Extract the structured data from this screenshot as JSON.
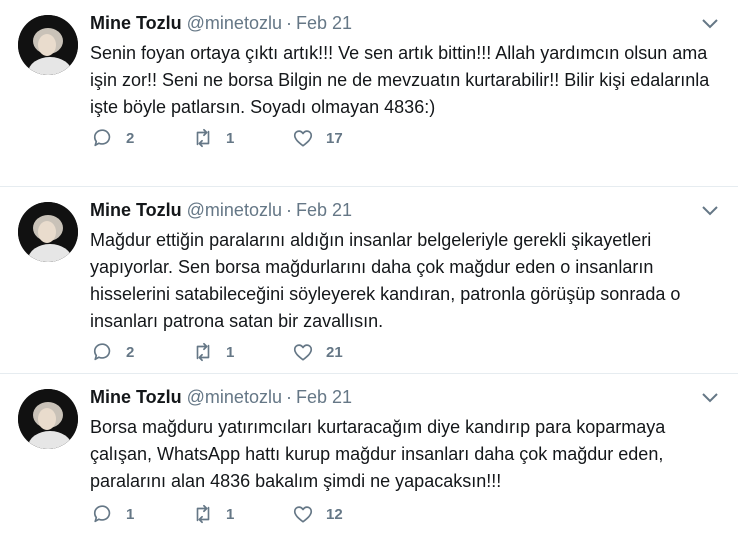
{
  "tweets": [
    {
      "name": "Mine Tozlu",
      "handle": "@minetozlu",
      "separator": "·",
      "date": "Feb 21",
      "text": "Senin foyan ortaya çıktı artık!!! Ve sen artık bittin!!! Allah yardımcın olsun ama işin zor!! Seni ne borsa Bilgin ne de mevzuatın kurtarabilir!! Bilir kişi edalarınla işte böyle patlarsın. Soyadı olmayan 4836:)",
      "replies": "2",
      "retweets": "1",
      "likes": "17"
    },
    {
      "name": "Mine Tozlu",
      "handle": "@minetozlu",
      "separator": "·",
      "date": "Feb 21",
      "text": "Mağdur ettiğin paralarını aldığın insanlar belgeleriyle gerekli şikayetleri yapıyorlar. Sen borsa mağdurlarını daha çok mağdur eden o insanların hisselerini satabileceğini söyleyerek kandıran, patronla görüşüp sonrada o insanları patrona satan bir zavallısın.",
      "replies": "2",
      "retweets": "1",
      "likes": "21"
    },
    {
      "name": "Mine Tozlu",
      "handle": "@minetozlu",
      "separator": "·",
      "date": "Feb 21",
      "text": "Borsa mağduru yatırımcıları kurtaracağım diye kandırıp para koparmaya çalışan, WhatsApp hattı kurup mağdur insanları daha çok mağdur eden, paralarını alan 4836 bakalım şimdi ne yapacaksın!!!",
      "replies": "1",
      "retweets": "1",
      "likes": "12"
    }
  ],
  "icons": {
    "reply": "reply-icon",
    "retweet": "retweet-icon",
    "like": "heart-icon",
    "menu": "chevron-down-icon"
  },
  "colors": {
    "text": "#14171a",
    "muted": "#657786",
    "divider": "#e6ecf0"
  }
}
